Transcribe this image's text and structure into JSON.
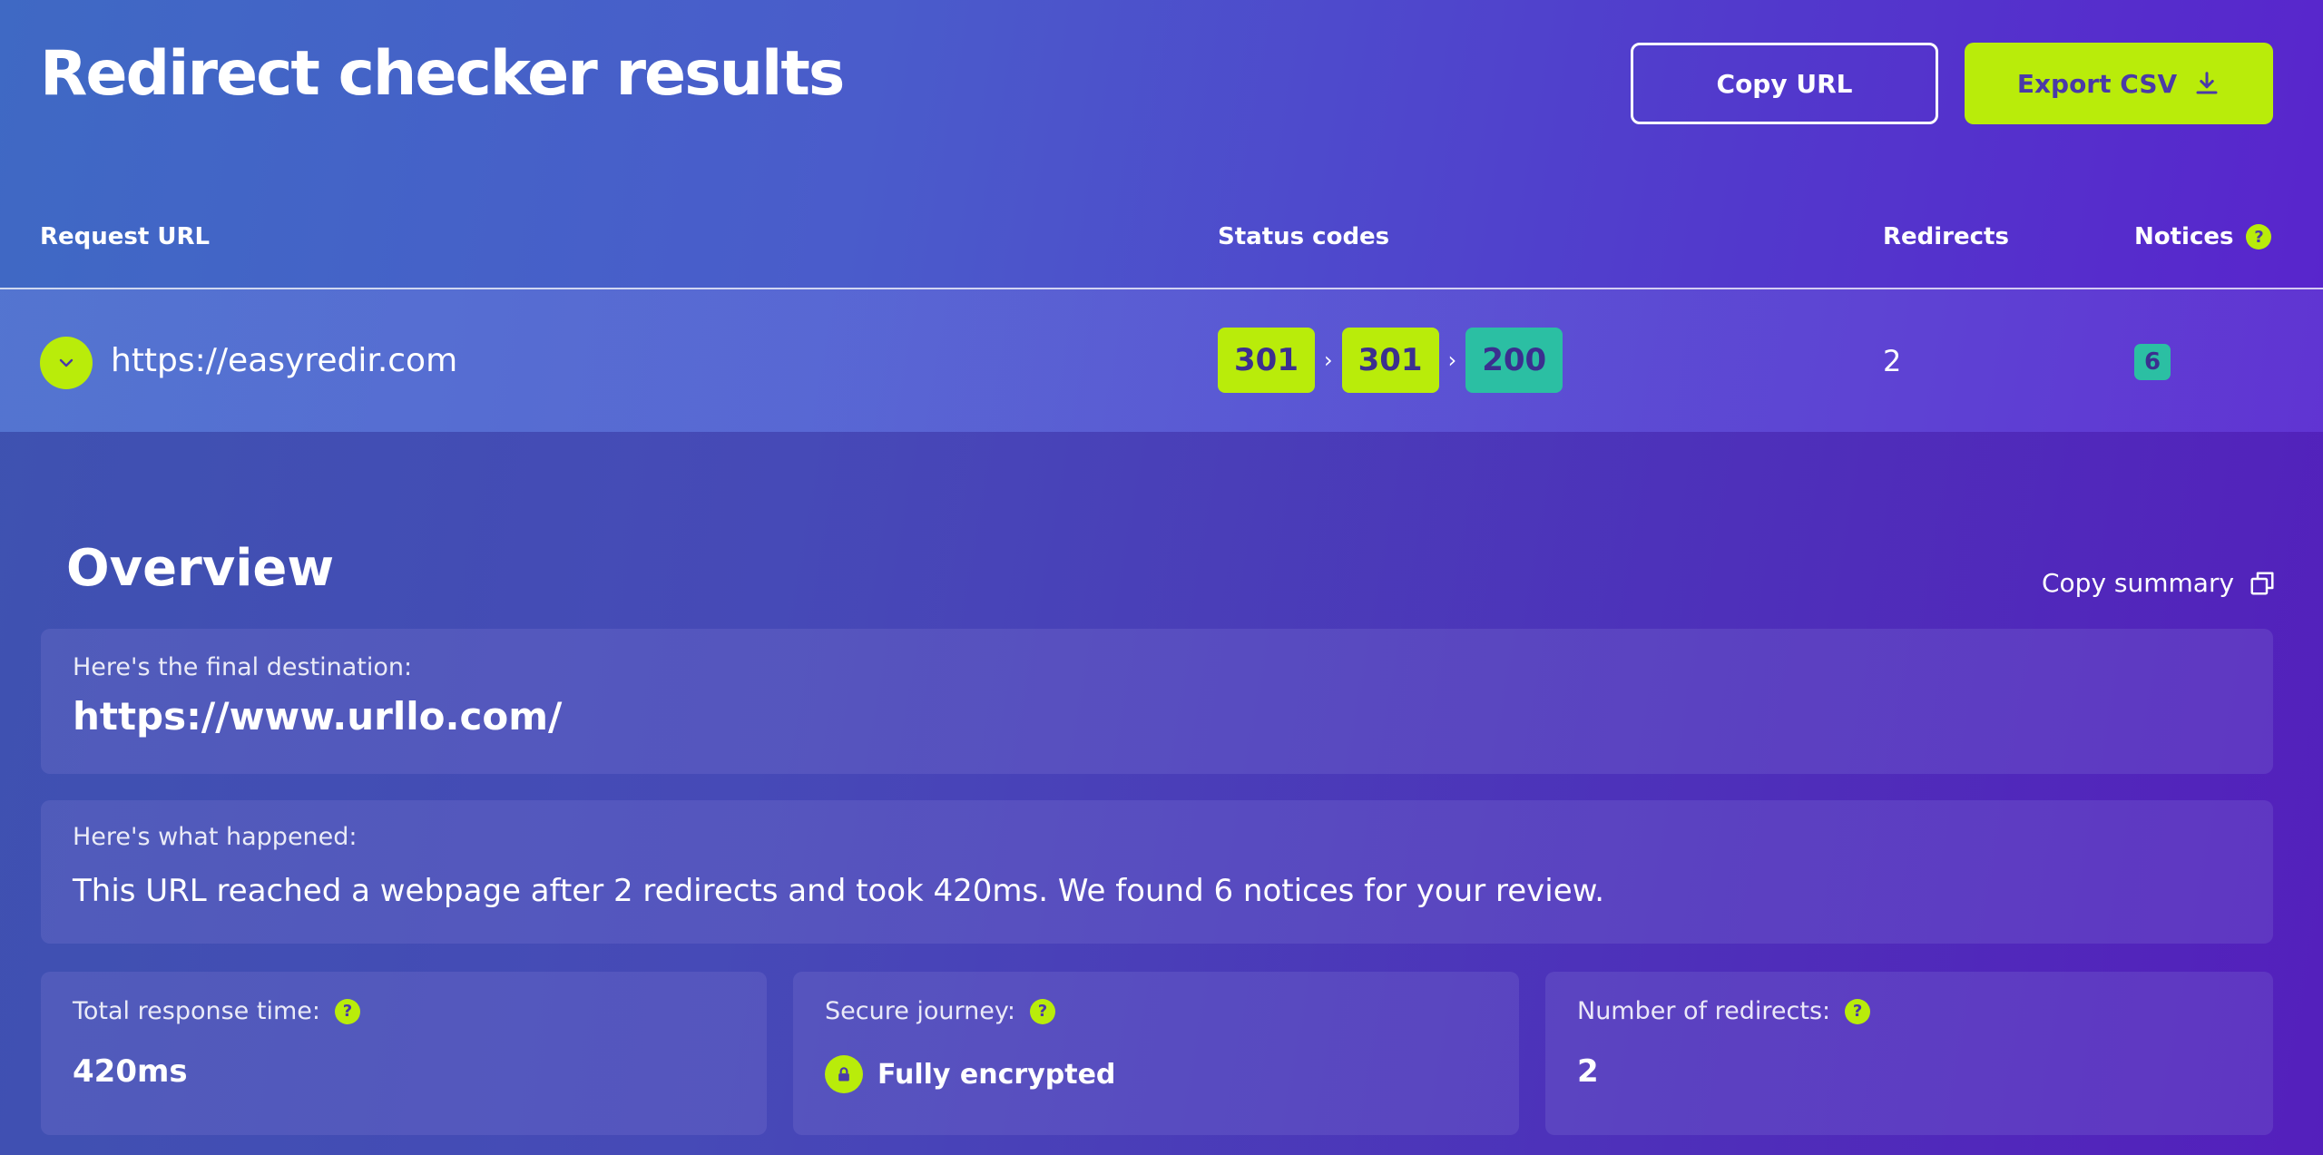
{
  "header": {
    "title": "Redirect checker results",
    "copy_url_label": "Copy URL",
    "export_csv_label": "Export CSV"
  },
  "table": {
    "columns": {
      "request_url": "Request URL",
      "status_codes": "Status codes",
      "redirects": "Redirects",
      "notices": "Notices"
    },
    "row": {
      "url": "https://easyredir.com",
      "status_codes": [
        "301",
        "301",
        "200"
      ],
      "redirects": "2",
      "notices": "6"
    }
  },
  "overview": {
    "title": "Overview",
    "copy_summary_label": "Copy summary",
    "final_destination_label": "Here's the final destination:",
    "final_destination_value": "https://www.urllo.com/",
    "what_happened_label": "Here's what happened:",
    "what_happened_value": "This URL reached a webpage after 2 redirects and took 420ms. We found 6 notices for your review.",
    "stats": {
      "response_time_label": "Total response time:",
      "response_time_value": "420ms",
      "secure_journey_label": "Secure journey:",
      "secure_journey_value": "Fully encrypted",
      "redirects_label": "Number of redirects:",
      "redirects_value": "2"
    }
  },
  "help_glyph": "?",
  "icons": [
    "download-icon",
    "chevron-down-icon",
    "copy-icon",
    "lock-icon",
    "help-icon"
  ],
  "colors": {
    "accent_lime": "#b9ec0a",
    "status_teal": "#2bbfa3",
    "text_dark": "#3b2f8f"
  }
}
